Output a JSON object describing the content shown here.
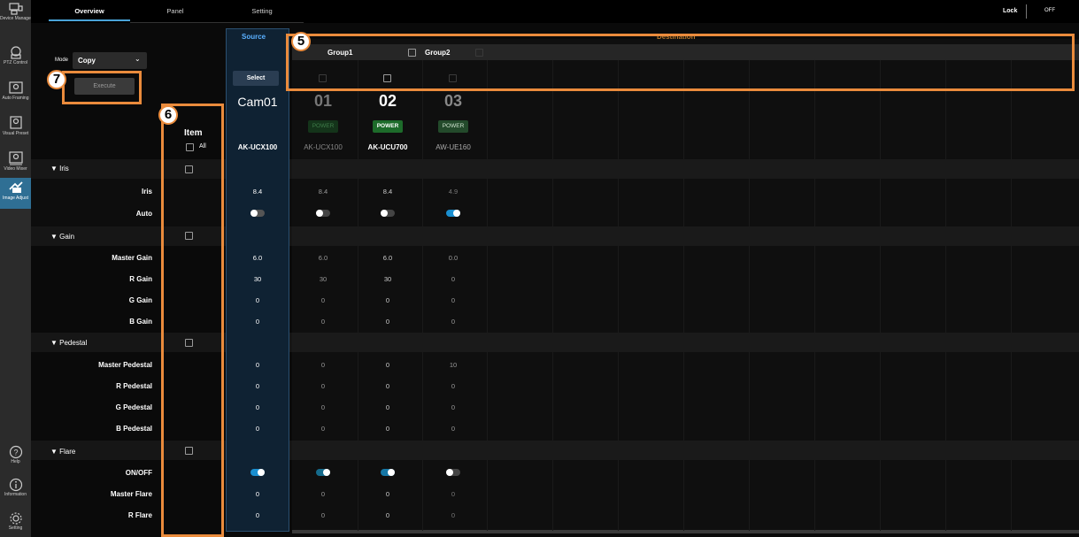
{
  "nav": {
    "items": [
      {
        "label": "Device Manager",
        "icon": "device-manager-icon"
      },
      {
        "label": "PTZ Control",
        "icon": "ptz-control-icon"
      },
      {
        "label": "Auto Framing",
        "icon": "auto-framing-icon"
      },
      {
        "label": "Visual Preset",
        "icon": "visual-preset-icon"
      },
      {
        "label": "Video Mixer",
        "icon": "video-mixer-icon"
      },
      {
        "label": "Image Adjust",
        "icon": "image-adjust-icon"
      }
    ],
    "bottom": [
      {
        "label": "Help",
        "icon": "help-icon"
      },
      {
        "label": "Information",
        "icon": "information-icon"
      },
      {
        "label": "Setting",
        "icon": "gear-icon"
      }
    ]
  },
  "tabs": [
    "Overview",
    "Panel",
    "Setting"
  ],
  "lock": {
    "label": "Lock",
    "state": "OFF"
  },
  "mode": {
    "label": "Mode",
    "value": "Copy",
    "execute": "Execute"
  },
  "source": {
    "title": "Source",
    "select": "Select",
    "name": "Cam01",
    "model": "AK-UCX100"
  },
  "destination": {
    "title": "Destination",
    "groups": [
      "Group1",
      "Group2"
    ]
  },
  "item": {
    "title": "Item",
    "all": "All"
  },
  "cameras": [
    {
      "num": "01",
      "power": "POWER",
      "model": "AK-UCX100"
    },
    {
      "num": "02",
      "power": "POWER",
      "model": "AK-UCU700"
    },
    {
      "num": "03",
      "power": "POWER",
      "model": "AW-UE160"
    }
  ],
  "sections": {
    "iris": {
      "title": "▼ Iris",
      "rows": [
        "Iris",
        "Auto"
      ]
    },
    "gain": {
      "title": "▼ Gain",
      "rows": [
        "Master Gain",
        "R Gain",
        "G Gain",
        "B Gain"
      ]
    },
    "pedestal": {
      "title": "▼ Pedestal",
      "rows": [
        "Master Pedestal",
        "R Pedestal",
        "G Pedestal",
        "B Pedestal"
      ]
    },
    "flare": {
      "title": "▼ Flare",
      "rows": [
        "ON/OFF",
        "Master Flare",
        "R Flare"
      ]
    }
  },
  "values": {
    "source": {
      "iris": "8.4",
      "master_gain": "6.0",
      "r_gain": "30",
      "g_gain": "0",
      "b_gain": "0",
      "master_ped": "0",
      "r_ped": "0",
      "g_ped": "0",
      "b_ped": "0",
      "master_flare": "0",
      "r_flare": "0"
    },
    "cam01": {
      "iris": "8.4",
      "master_gain": "6.0",
      "r_gain": "30",
      "g_gain": "0",
      "b_gain": "0",
      "master_ped": "0",
      "r_ped": "0",
      "g_ped": "0",
      "b_ped": "0",
      "master_flare": "0",
      "r_flare": "0"
    },
    "cam02": {
      "iris": "8.4",
      "master_gain": "6.0",
      "r_gain": "30",
      "g_gain": "0",
      "b_gain": "0",
      "master_ped": "0",
      "r_ped": "0",
      "g_ped": "0",
      "b_ped": "0",
      "master_flare": "0",
      "r_flare": "0"
    },
    "cam03": {
      "iris": "4.9",
      "master_gain": "0.0",
      "r_gain": "0",
      "g_gain": "0",
      "b_gain": "0",
      "master_ped": "10",
      "r_ped": "0",
      "g_ped": "0",
      "b_ped": "0",
      "master_flare": "0",
      "r_flare": "0"
    }
  },
  "callouts": [
    "5",
    "6",
    "7"
  ],
  "colors": {
    "accent": "#2f6f94",
    "power_green": "#1d6b2a",
    "callout": "#ea8b3c",
    "toggle_on": "#1a8fd0"
  }
}
